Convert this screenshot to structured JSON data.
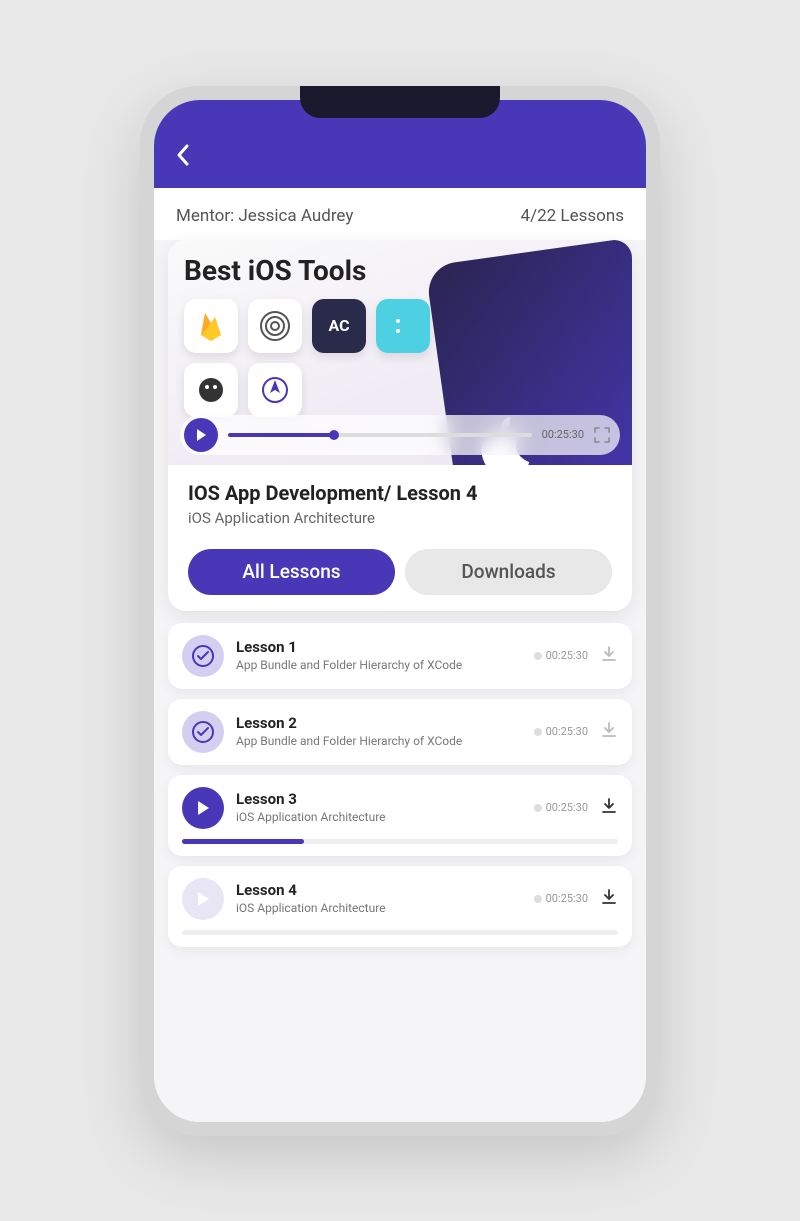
{
  "header": {
    "mentor_label": "Mentor: Jessica Audrey",
    "progress_label": "4/22 Lessons"
  },
  "video": {
    "banner_title": "Best iOS Tools",
    "timestamp": "00:25:30"
  },
  "course": {
    "title": "IOS App Development/ Lesson 4",
    "subtitle": "iOS Application Architecture"
  },
  "tabs": {
    "all_lessons": "All Lessons",
    "downloads": "Downloads"
  },
  "lessons": [
    {
      "name": "Lesson 1",
      "desc": "App Bundle and Folder Hierarchy of XCode",
      "time": "00:25:30",
      "status": "done",
      "progress": null
    },
    {
      "name": "Lesson 2",
      "desc": "App Bundle and Folder Hierarchy of XCode",
      "time": "00:25:30",
      "status": "done",
      "progress": null
    },
    {
      "name": "Lesson 3",
      "desc": "iOS Application Architecture",
      "time": "00:25:30",
      "status": "playing",
      "progress": 28
    },
    {
      "name": "Lesson 4",
      "desc": "iOS Application Architecture",
      "time": "00:25:30",
      "status": "pending",
      "progress": 0
    }
  ]
}
